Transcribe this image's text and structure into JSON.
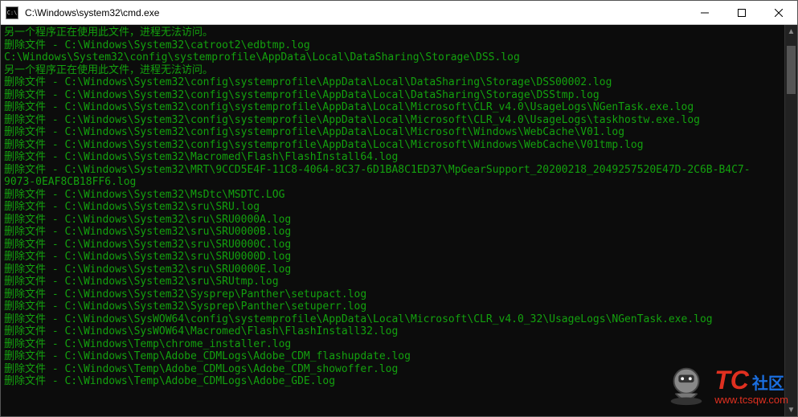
{
  "window": {
    "title": "C:\\Windows\\system32\\cmd.exe"
  },
  "console": {
    "msg_in_use": "另一个程序正在使用此文件，进程无法访问。",
    "delete_prefix": "删除文件 - ",
    "lines": [
      {
        "t": "msg",
        "key": "msg_in_use"
      },
      {
        "t": "del",
        "path": "C:\\Windows\\System32\\catroot2\\edbtmp.log"
      },
      {
        "t": "raw",
        "text": "C:\\Windows\\System32\\config\\systemprofile\\AppData\\Local\\DataSharing\\Storage\\DSS.log"
      },
      {
        "t": "msg",
        "key": "msg_in_use"
      },
      {
        "t": "del",
        "path": "C:\\Windows\\System32\\config\\systemprofile\\AppData\\Local\\DataSharing\\Storage\\DSS00002.log"
      },
      {
        "t": "del",
        "path": "C:\\Windows\\System32\\config\\systemprofile\\AppData\\Local\\DataSharing\\Storage\\DSStmp.log"
      },
      {
        "t": "del",
        "path": "C:\\Windows\\System32\\config\\systemprofile\\AppData\\Local\\Microsoft\\CLR_v4.0\\UsageLogs\\NGenTask.exe.log"
      },
      {
        "t": "del",
        "path": "C:\\Windows\\System32\\config\\systemprofile\\AppData\\Local\\Microsoft\\CLR_v4.0\\UsageLogs\\taskhostw.exe.log"
      },
      {
        "t": "del",
        "path": "C:\\Windows\\System32\\config\\systemprofile\\AppData\\Local\\Microsoft\\Windows\\WebCache\\V01.log"
      },
      {
        "t": "del",
        "path": "C:\\Windows\\System32\\config\\systemprofile\\AppData\\Local\\Microsoft\\Windows\\WebCache\\V01tmp.log"
      },
      {
        "t": "del",
        "path": "C:\\Windows\\System32\\Macromed\\Flash\\FlashInstall64.log"
      },
      {
        "t": "del",
        "path": "C:\\Windows\\System32\\MRT\\9CCD5E4F-11C8-4064-8C37-6D1BA8C1ED37\\MpGearSupport_20200218_2049257520E47D-2C6B-B4C7-"
      },
      {
        "t": "raw",
        "text": "9073-0EAF8CB18FF6.log"
      },
      {
        "t": "del",
        "path": "C:\\Windows\\System32\\MsDtc\\MSDTC.LOG"
      },
      {
        "t": "del",
        "path": "C:\\Windows\\System32\\sru\\SRU.log"
      },
      {
        "t": "del",
        "path": "C:\\Windows\\System32\\sru\\SRU0000A.log"
      },
      {
        "t": "del",
        "path": "C:\\Windows\\System32\\sru\\SRU0000B.log"
      },
      {
        "t": "del",
        "path": "C:\\Windows\\System32\\sru\\SRU0000C.log"
      },
      {
        "t": "del",
        "path": "C:\\Windows\\System32\\sru\\SRU0000D.log"
      },
      {
        "t": "del",
        "path": "C:\\Windows\\System32\\sru\\SRU0000E.log"
      },
      {
        "t": "del",
        "path": "C:\\Windows\\System32\\sru\\SRUtmp.log"
      },
      {
        "t": "del",
        "path": "C:\\Windows\\System32\\Sysprep\\Panther\\setupact.log"
      },
      {
        "t": "del",
        "path": "C:\\Windows\\System32\\Sysprep\\Panther\\setuperr.log"
      },
      {
        "t": "del",
        "path": "C:\\Windows\\SysWOW64\\config\\systemprofile\\AppData\\Local\\Microsoft\\CLR_v4.0_32\\UsageLogs\\NGenTask.exe.log"
      },
      {
        "t": "del",
        "path": "C:\\Windows\\SysWOW64\\Macromed\\Flash\\FlashInstall32.log"
      },
      {
        "t": "del",
        "path": "C:\\Windows\\Temp\\chrome_installer.log"
      },
      {
        "t": "del",
        "path": "C:\\Windows\\Temp\\Adobe_CDMLogs\\Adobe_CDM_flashupdate.log"
      },
      {
        "t": "del",
        "path": "C:\\Windows\\Temp\\Adobe_CDMLogs\\Adobe_CDM_showoffer.log"
      },
      {
        "t": "del",
        "path": "C:\\Windows\\Temp\\Adobe_CDMLogs\\Adobe_GDE.log"
      }
    ]
  },
  "watermark": {
    "main": "TC",
    "tag": "社区",
    "url": "www.tcsqw.com"
  }
}
